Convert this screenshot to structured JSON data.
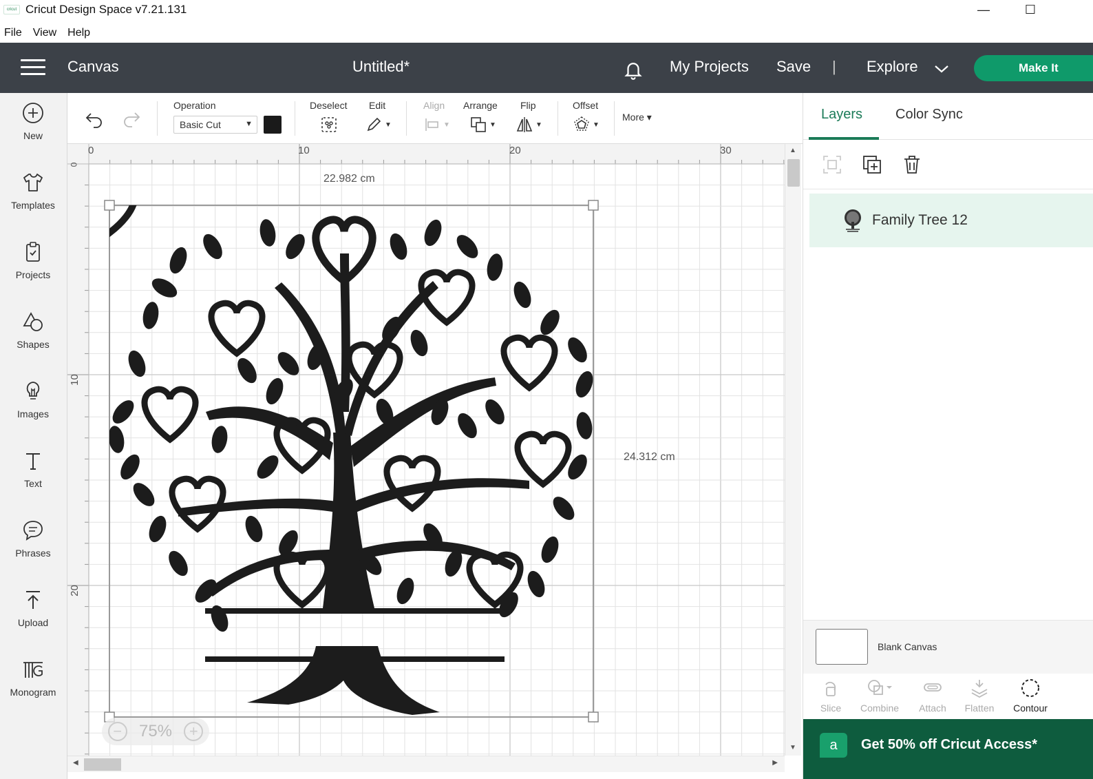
{
  "window": {
    "logo_text": "cricut",
    "title": "Cricut Design Space  v7.21.131",
    "minimize": "—",
    "maximize": "☐"
  },
  "menu": {
    "items": [
      "File",
      "View",
      "Help"
    ]
  },
  "topbar": {
    "section": "Canvas",
    "project_title": "Untitled*",
    "my_projects": "My Projects",
    "save": "Save",
    "divider": "|",
    "explore": "Explore",
    "make_it": "Make It"
  },
  "sidebar": {
    "items": [
      {
        "label": "New",
        "icon": "plus-circle-icon"
      },
      {
        "label": "Templates",
        "icon": "shirt-icon"
      },
      {
        "label": "Projects",
        "icon": "clipboard-icon"
      },
      {
        "label": "Shapes",
        "icon": "shapes-icon"
      },
      {
        "label": "Images",
        "icon": "lightbulb-icon"
      },
      {
        "label": "Text",
        "icon": "text-icon"
      },
      {
        "label": "Phrases",
        "icon": "speech-bubble-icon"
      },
      {
        "label": "Upload",
        "icon": "upload-icon"
      },
      {
        "label": "Monogram",
        "icon": "monogram-icon"
      }
    ]
  },
  "toolbar": {
    "operation_label": "Operation",
    "operation_value": "Basic Cut",
    "operation_color": "#1a1a1a",
    "deselect": "Deselect",
    "edit": "Edit",
    "align": "Align",
    "arrange": "Arrange",
    "flip": "Flip",
    "offset": "Offset",
    "more": "More ▾"
  },
  "canvas": {
    "ruler_top": [
      "0",
      "10",
      "20",
      "30"
    ],
    "ruler_left": [
      "0",
      "10",
      "20"
    ],
    "width_label": "22.982 cm",
    "height_label": "24.312 cm",
    "zoom_minus": "−",
    "zoom_level": "75%",
    "zoom_plus": "+"
  },
  "layers_panel": {
    "tabs": [
      "Layers",
      "Color Sync"
    ],
    "layers": [
      {
        "name": "Family Tree 12"
      }
    ],
    "blank_canvas": "Blank Canvas",
    "actions": [
      "Slice",
      "Combine",
      "Attach",
      "Flatten",
      "Contour"
    ],
    "promo": "Get 50% off Cricut Access*",
    "promo_badge": "a"
  },
  "colors": {
    "topbar": "#3c4148",
    "accent": "#0f9a6a",
    "selected_layer": "#e6f5ee",
    "promo": "#0e5c3e"
  }
}
